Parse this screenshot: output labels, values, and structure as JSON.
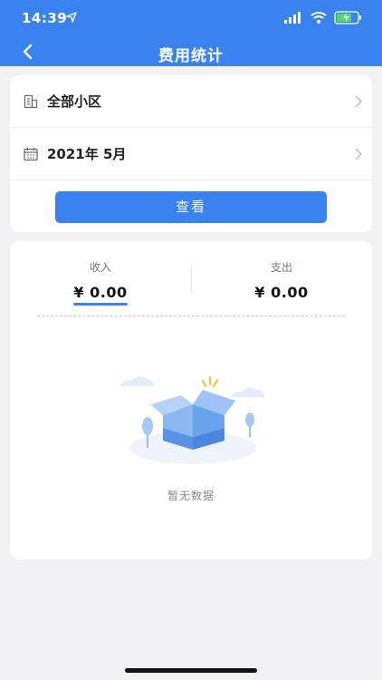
{
  "status_bar": {
    "time": "14:39"
  },
  "header": {
    "title": "费用统计"
  },
  "filters": {
    "community": "全部小区",
    "date": "2021年 5月",
    "view_button": "查看"
  },
  "summary": {
    "income_label": "收入",
    "income_value": "¥ 0.00",
    "expense_label": "支出",
    "expense_value": "¥ 0.00"
  },
  "empty_state": {
    "text": "暂无数据"
  },
  "colors": {
    "primary": "#3a82f0",
    "background": "#f2f2f4"
  }
}
